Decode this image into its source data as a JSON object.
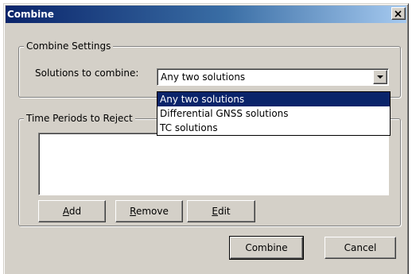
{
  "window": {
    "title": "Combine",
    "close_icon": "close-icon"
  },
  "settings": {
    "legend": "Combine Settings",
    "solutions_label": "Solutions to combine:",
    "selected_value": "Any two solutions",
    "options": [
      "Any two solutions",
      "Differential GNSS solutions",
      "TC solutions"
    ],
    "highlighted_index": 0
  },
  "periods": {
    "legend": "Time Periods to Reject",
    "add_label": "Add",
    "remove_label": "Remove",
    "edit_label": "Edit"
  },
  "footer": {
    "combine_label": "Combine",
    "cancel_label": "Cancel"
  },
  "colors": {
    "face": "#d4d0c8",
    "title_active": "#0a246a",
    "highlight": "#0a246a"
  }
}
